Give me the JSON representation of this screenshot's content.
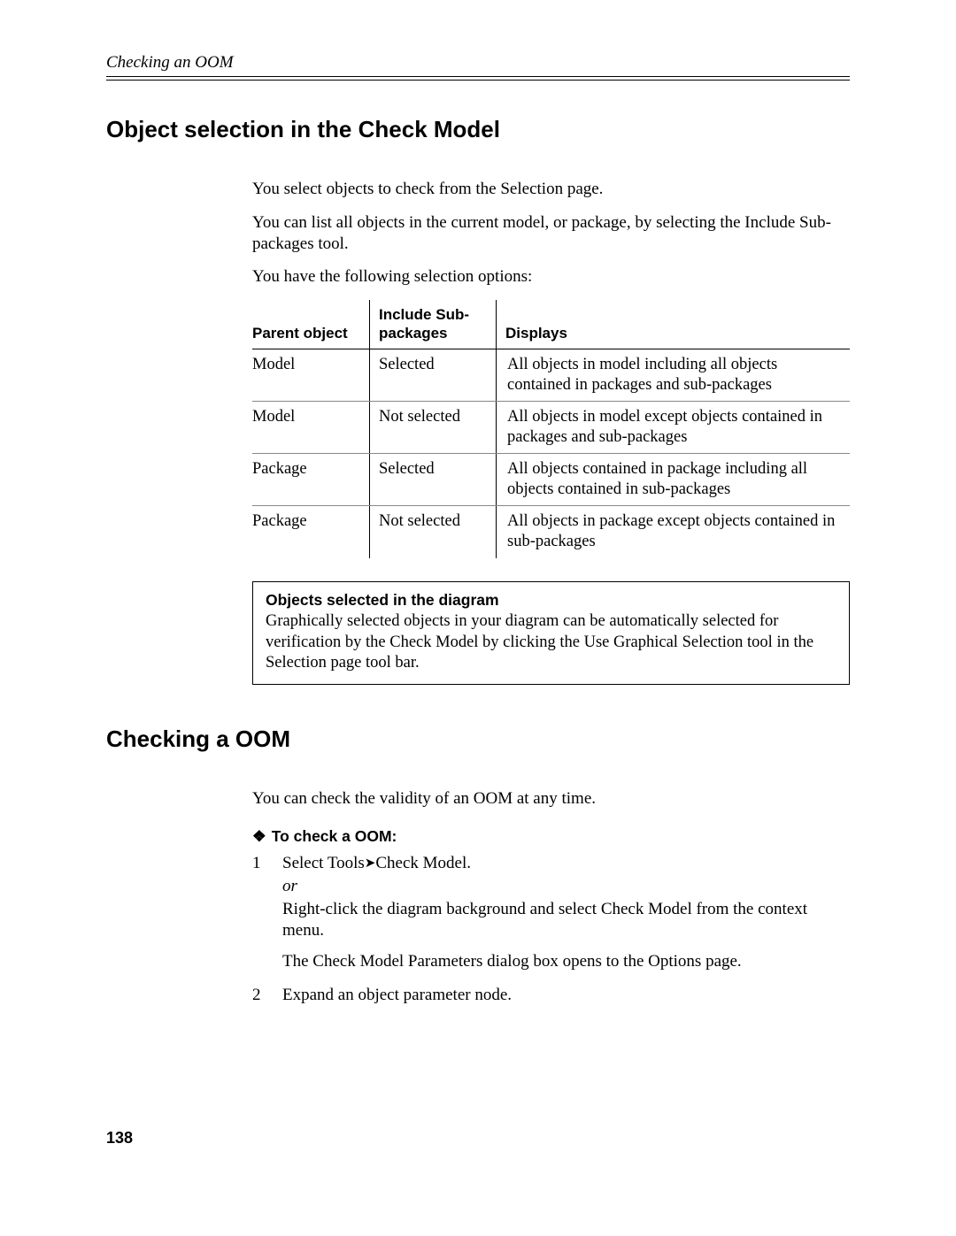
{
  "running_head": "Checking an OOM",
  "section1": {
    "title": "Object selection in the Check Model",
    "p1": "You select objects to check from the Selection page.",
    "p2": "You can list all objects in the current model, or package, by selecting the Include Sub-packages tool.",
    "p3": "You have the following selection options:",
    "table": {
      "h1": "Parent object",
      "h2": "Include Sub-packages",
      "h3": "Displays",
      "rows": [
        {
          "a": "Model",
          "b": "Selected",
          "c": "All objects in model including all objects contained in packages and sub-packages"
        },
        {
          "a": "Model",
          "b": "Not selected",
          "c": "All objects in model except objects contained in packages and sub-packages"
        },
        {
          "a": "Package",
          "b": "Selected",
          "c": "All objects contained in package including all objects contained in sub-packages"
        },
        {
          "a": "Package",
          "b": "Not selected",
          "c": "All objects in package except objects contained in sub-packages"
        }
      ]
    },
    "note": {
      "title": "Objects selected in the diagram",
      "body": "Graphically selected objects in your diagram can be automatically selected for verification by the Check Model by clicking the Use Graphical Selection tool in the Selection page tool bar."
    }
  },
  "section2": {
    "title": "Checking a OOM",
    "intro": "You can check the validity of an OOM at any time.",
    "proc_title": "To check a OOM:",
    "steps": {
      "s1_line1a": "Select Tools",
      "s1_line1b": "Check Model.",
      "s1_or": "or",
      "s1_alt": "Right-click the diagram background and select Check Model from the context menu.",
      "s1_result": "The Check Model Parameters dialog box opens to the Options page.",
      "s2": "Expand an object parameter node."
    }
  },
  "page_number": "138"
}
